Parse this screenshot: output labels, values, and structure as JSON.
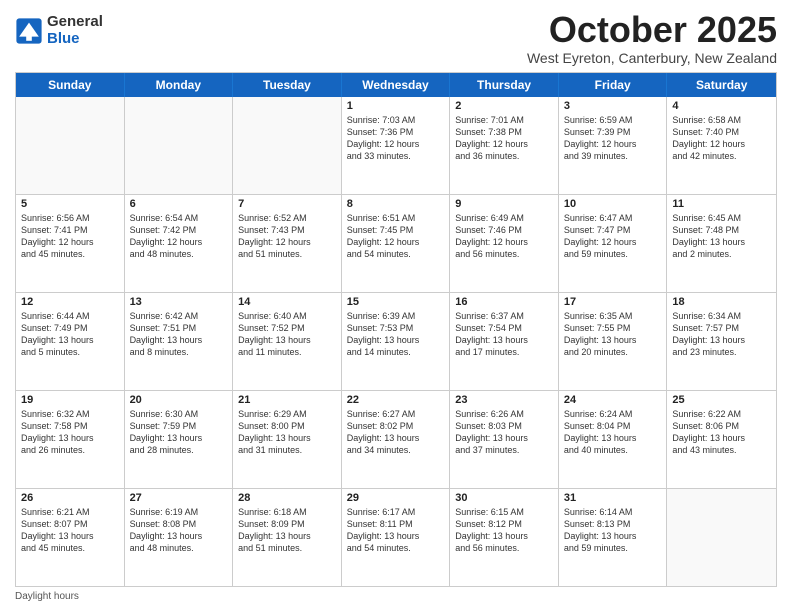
{
  "header": {
    "logo": {
      "general": "General",
      "blue": "Blue"
    },
    "title": "October 2025",
    "location": "West Eyreton, Canterbury, New Zealand"
  },
  "days": [
    "Sunday",
    "Monday",
    "Tuesday",
    "Wednesday",
    "Thursday",
    "Friday",
    "Saturday"
  ],
  "footer": "Daylight hours",
  "weeks": [
    [
      {
        "day": "",
        "empty": true,
        "content": ""
      },
      {
        "day": "",
        "empty": true,
        "content": ""
      },
      {
        "day": "",
        "empty": true,
        "content": ""
      },
      {
        "day": "1",
        "content": "Sunrise: 7:03 AM\nSunset: 7:36 PM\nDaylight: 12 hours\nand 33 minutes."
      },
      {
        "day": "2",
        "content": "Sunrise: 7:01 AM\nSunset: 7:38 PM\nDaylight: 12 hours\nand 36 minutes."
      },
      {
        "day": "3",
        "content": "Sunrise: 6:59 AM\nSunset: 7:39 PM\nDaylight: 12 hours\nand 39 minutes."
      },
      {
        "day": "4",
        "content": "Sunrise: 6:58 AM\nSunset: 7:40 PM\nDaylight: 12 hours\nand 42 minutes."
      }
    ],
    [
      {
        "day": "5",
        "content": "Sunrise: 6:56 AM\nSunset: 7:41 PM\nDaylight: 12 hours\nand 45 minutes."
      },
      {
        "day": "6",
        "content": "Sunrise: 6:54 AM\nSunset: 7:42 PM\nDaylight: 12 hours\nand 48 minutes."
      },
      {
        "day": "7",
        "content": "Sunrise: 6:52 AM\nSunset: 7:43 PM\nDaylight: 12 hours\nand 51 minutes."
      },
      {
        "day": "8",
        "content": "Sunrise: 6:51 AM\nSunset: 7:45 PM\nDaylight: 12 hours\nand 54 minutes."
      },
      {
        "day": "9",
        "content": "Sunrise: 6:49 AM\nSunset: 7:46 PM\nDaylight: 12 hours\nand 56 minutes."
      },
      {
        "day": "10",
        "content": "Sunrise: 6:47 AM\nSunset: 7:47 PM\nDaylight: 12 hours\nand 59 minutes."
      },
      {
        "day": "11",
        "content": "Sunrise: 6:45 AM\nSunset: 7:48 PM\nDaylight: 13 hours\nand 2 minutes."
      }
    ],
    [
      {
        "day": "12",
        "content": "Sunrise: 6:44 AM\nSunset: 7:49 PM\nDaylight: 13 hours\nand 5 minutes."
      },
      {
        "day": "13",
        "content": "Sunrise: 6:42 AM\nSunset: 7:51 PM\nDaylight: 13 hours\nand 8 minutes."
      },
      {
        "day": "14",
        "content": "Sunrise: 6:40 AM\nSunset: 7:52 PM\nDaylight: 13 hours\nand 11 minutes."
      },
      {
        "day": "15",
        "content": "Sunrise: 6:39 AM\nSunset: 7:53 PM\nDaylight: 13 hours\nand 14 minutes."
      },
      {
        "day": "16",
        "content": "Sunrise: 6:37 AM\nSunset: 7:54 PM\nDaylight: 13 hours\nand 17 minutes."
      },
      {
        "day": "17",
        "content": "Sunrise: 6:35 AM\nSunset: 7:55 PM\nDaylight: 13 hours\nand 20 minutes."
      },
      {
        "day": "18",
        "content": "Sunrise: 6:34 AM\nSunset: 7:57 PM\nDaylight: 13 hours\nand 23 minutes."
      }
    ],
    [
      {
        "day": "19",
        "content": "Sunrise: 6:32 AM\nSunset: 7:58 PM\nDaylight: 13 hours\nand 26 minutes."
      },
      {
        "day": "20",
        "content": "Sunrise: 6:30 AM\nSunset: 7:59 PM\nDaylight: 13 hours\nand 28 minutes."
      },
      {
        "day": "21",
        "content": "Sunrise: 6:29 AM\nSunset: 8:00 PM\nDaylight: 13 hours\nand 31 minutes."
      },
      {
        "day": "22",
        "content": "Sunrise: 6:27 AM\nSunset: 8:02 PM\nDaylight: 13 hours\nand 34 minutes."
      },
      {
        "day": "23",
        "content": "Sunrise: 6:26 AM\nSunset: 8:03 PM\nDaylight: 13 hours\nand 37 minutes."
      },
      {
        "day": "24",
        "content": "Sunrise: 6:24 AM\nSunset: 8:04 PM\nDaylight: 13 hours\nand 40 minutes."
      },
      {
        "day": "25",
        "content": "Sunrise: 6:22 AM\nSunset: 8:06 PM\nDaylight: 13 hours\nand 43 minutes."
      }
    ],
    [
      {
        "day": "26",
        "content": "Sunrise: 6:21 AM\nSunset: 8:07 PM\nDaylight: 13 hours\nand 45 minutes."
      },
      {
        "day": "27",
        "content": "Sunrise: 6:19 AM\nSunset: 8:08 PM\nDaylight: 13 hours\nand 48 minutes."
      },
      {
        "day": "28",
        "content": "Sunrise: 6:18 AM\nSunset: 8:09 PM\nDaylight: 13 hours\nand 51 minutes."
      },
      {
        "day": "29",
        "content": "Sunrise: 6:17 AM\nSunset: 8:11 PM\nDaylight: 13 hours\nand 54 minutes."
      },
      {
        "day": "30",
        "content": "Sunrise: 6:15 AM\nSunset: 8:12 PM\nDaylight: 13 hours\nand 56 minutes."
      },
      {
        "day": "31",
        "content": "Sunrise: 6:14 AM\nSunset: 8:13 PM\nDaylight: 13 hours\nand 59 minutes."
      },
      {
        "day": "",
        "empty": true,
        "content": ""
      }
    ]
  ]
}
